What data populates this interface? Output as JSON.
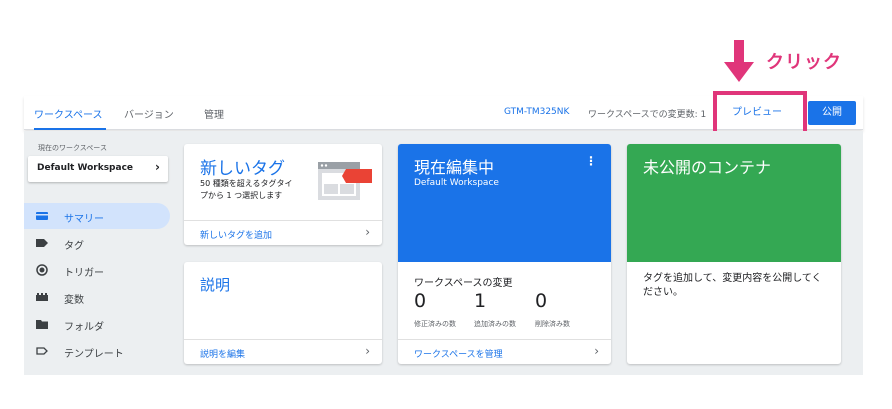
{
  "annotation": {
    "label": "クリック",
    "color": "#e0357a"
  },
  "topnav": {
    "tabs": [
      {
        "label": "ワークスペース",
        "active": true
      },
      {
        "label": "バージョン",
        "active": false
      },
      {
        "label": "管理",
        "active": false
      }
    ],
    "container_id": "GTM-TM325NK",
    "changes_text": "ワークスペースでの変更数: 1",
    "preview_label": "プレビュー",
    "publish_label": "公開"
  },
  "sidebar": {
    "workspace_caption": "現在のワークスペース",
    "workspace_name": "Default Workspace",
    "items": [
      {
        "label": "サマリー",
        "icon": "summary-icon",
        "active": true
      },
      {
        "label": "タグ",
        "icon": "tag-icon",
        "active": false
      },
      {
        "label": "トリガー",
        "icon": "trigger-icon",
        "active": false
      },
      {
        "label": "変数",
        "icon": "variable-icon",
        "active": false
      },
      {
        "label": "フォルダ",
        "icon": "folder-icon",
        "active": false
      },
      {
        "label": "テンプレート",
        "icon": "template-icon",
        "active": false
      }
    ]
  },
  "cards": {
    "new_tag": {
      "title": "新しいタグ",
      "description": "50 種類を超えるタグタイプから 1 つ選択します",
      "link": "新しいタグを追加"
    },
    "description": {
      "title": "説明",
      "link": "説明を編集"
    },
    "editing": {
      "title": "現在編集中",
      "subtitle": "Default Workspace",
      "changes_heading": "ワークスペースの変更",
      "stats": [
        {
          "value": "0",
          "label": "修正済みの数"
        },
        {
          "value": "1",
          "label": "追加済みの数"
        },
        {
          "value": "0",
          "label": "削除済み数"
        }
      ],
      "link": "ワークスペースを管理"
    },
    "unpublished": {
      "title": "未公開のコンテナ",
      "body": "タグを追加して、変更内容を公開してください。"
    }
  },
  "colors": {
    "accent": "#1a73e8",
    "green": "#34a853",
    "highlight": "#e0357a"
  }
}
